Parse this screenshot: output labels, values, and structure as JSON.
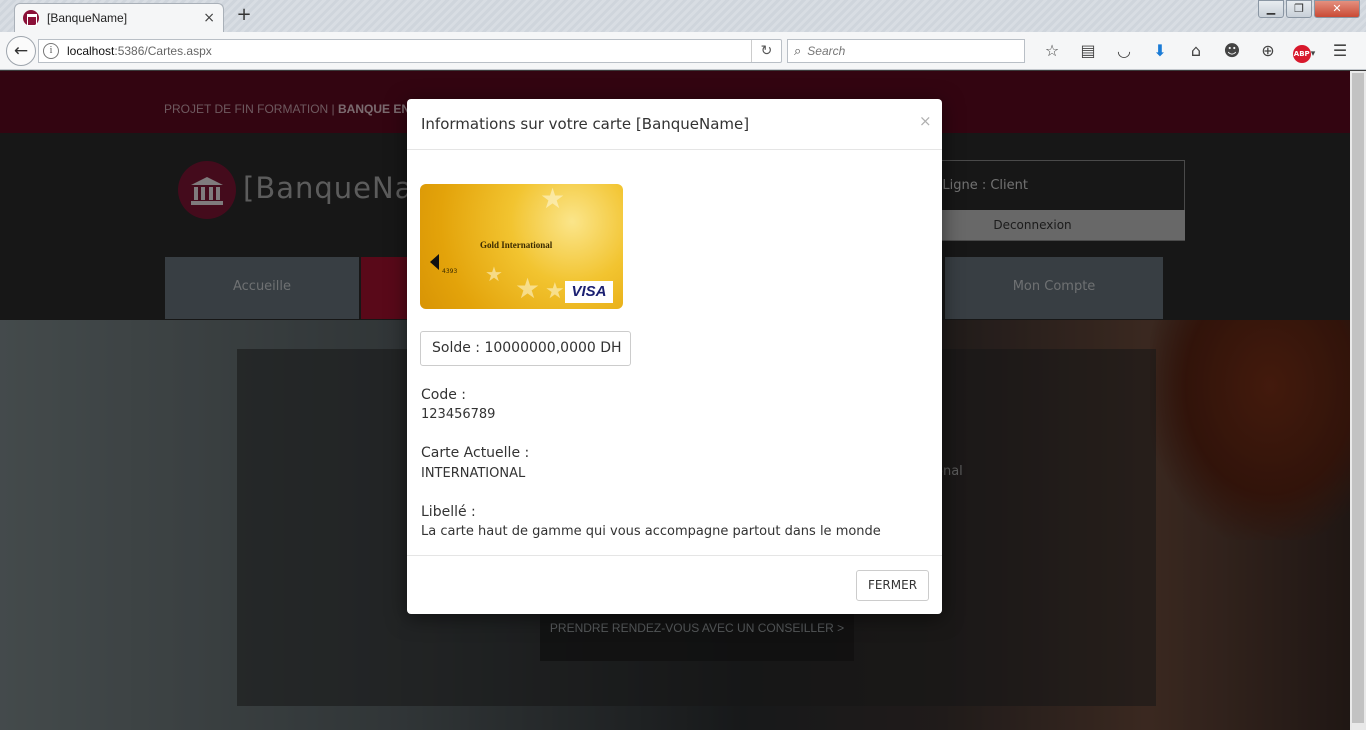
{
  "browser": {
    "tab_title": "[BanqueName]",
    "tab_close": "×",
    "new_tab": "+",
    "url_host": "localhost",
    "url_rest": ":5386/Cartes.aspx",
    "search_placeholder": "Search",
    "window_buttons": {
      "minimize": "▁",
      "maximize": "❐",
      "close": "✕"
    }
  },
  "site": {
    "topband_prefix": "PROJET DE FIN FORMATION | ",
    "topband_bold": "BANQUE EN",
    "logo_text": "[BanqueNa",
    "login_label": "n Ligne : Client",
    "logout": "Deconnexion",
    "nav": {
      "home": "Accueille",
      "account": "Mon Compte"
    },
    "hero_button": "PRENDRE RENDEZ-VOUS AVEC UN CONSEILLER >",
    "ghost_text": "onal",
    "colors": {
      "brand": "#5d0a20",
      "active_tab": "#a3122e"
    }
  },
  "modal": {
    "title": "Informations sur votre carte [BanqueName]",
    "close": "×",
    "card": {
      "name": "Gold International",
      "number_fragment": "4393",
      "brand": "VISA"
    },
    "solde": "Solde : 10000000,0000 DH",
    "code_label": "Code :",
    "code_value": "123456789",
    "carte_label": "Carte Actuelle :",
    "carte_value": "INTERNATIONAL",
    "libelle_label": "Libellé :",
    "libelle_value": "La carte haut de gamme qui vous accompagne partout dans le monde",
    "fermer": "FERMER"
  }
}
